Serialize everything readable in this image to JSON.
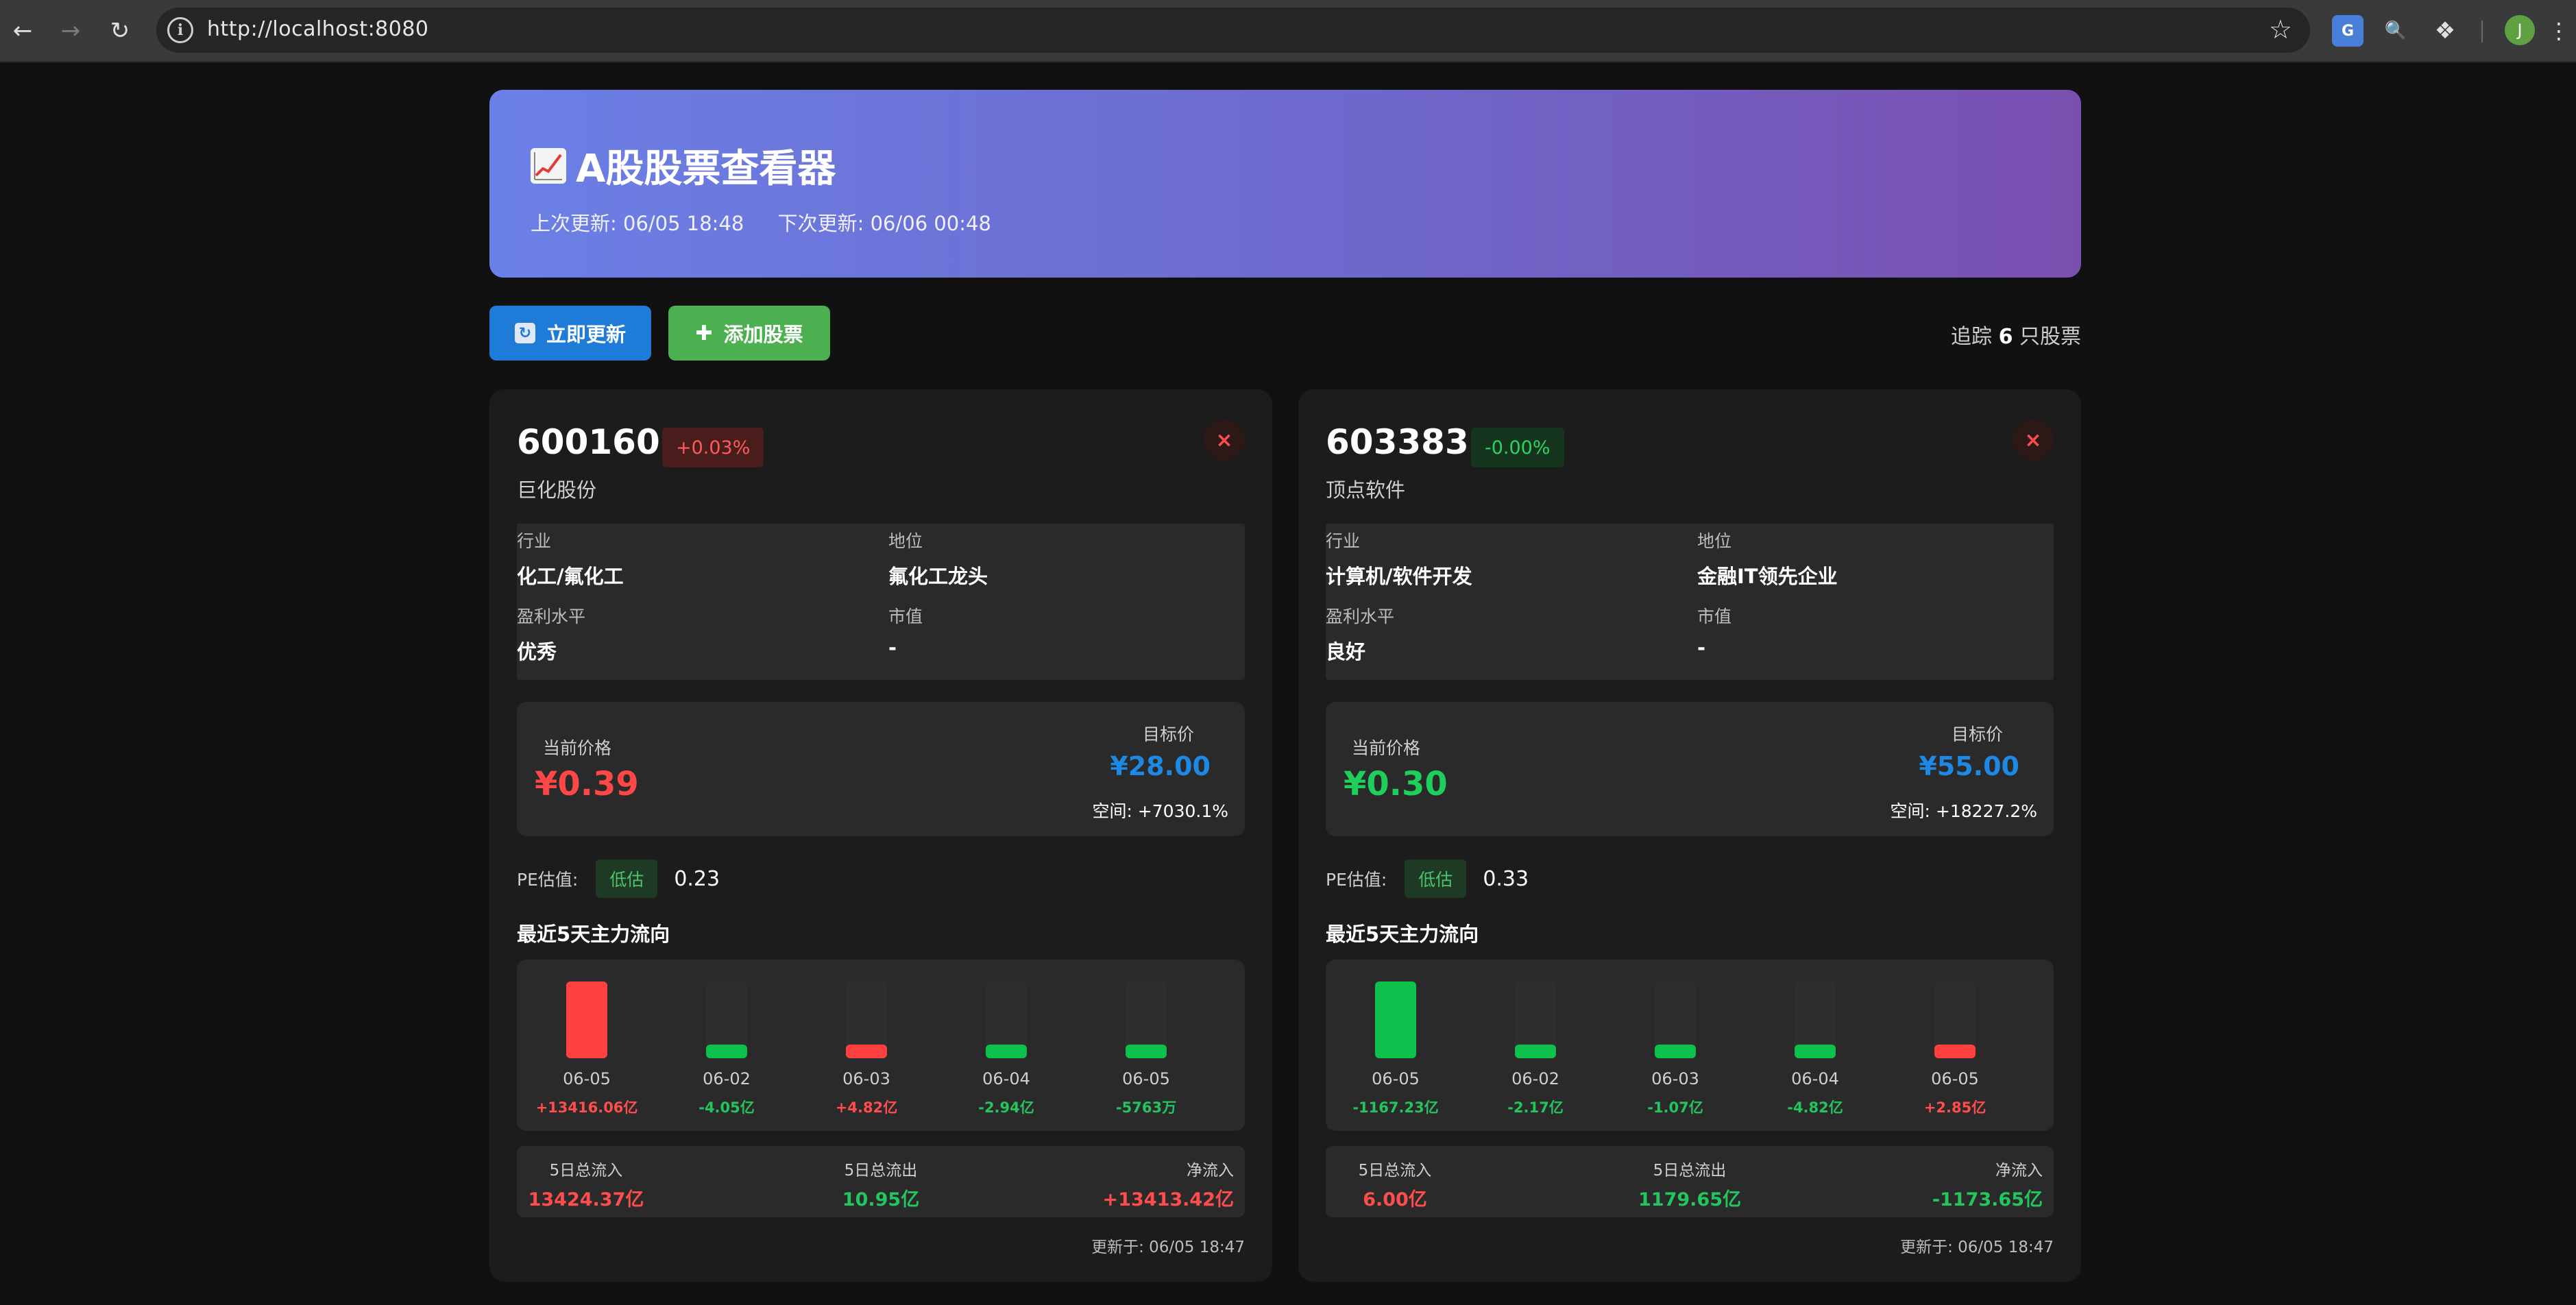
{
  "browser": {
    "url": "http://localhost:8080",
    "translate_ext_label": "G",
    "stock_ext_label": "🔍",
    "avatar_initial": "J"
  },
  "header": {
    "title": "A股股票查看器",
    "last_update": "上次更新: 06/05 18:48",
    "next_update": "下次更新: 06/06 00:48"
  },
  "actions": {
    "refresh_label": "立即更新",
    "add_label": "添加股票",
    "tracking_prefix": "追踪",
    "tracking_count": "6",
    "tracking_suffix": "只股票"
  },
  "labels": {
    "industry": "行业",
    "position": "地位",
    "profit_level": "盈利水平",
    "market_cap": "市值",
    "current_price": "当前价格",
    "target_price": "目标价",
    "pe_label": "PE估值:",
    "flow_title": "最近5天主力流向",
    "total_inflow": "5日总流入",
    "total_outflow": "5日总流出",
    "net_inflow": "净流入",
    "remove_symbol": "×"
  },
  "stocks": [
    {
      "code": "600160",
      "change": "+0.03%",
      "change_direction": "up",
      "name": "巨化股份",
      "industry": "化工/氟化工",
      "position": "氟化工龙头",
      "profit_level": "优秀",
      "market_cap": "-",
      "current_price": "¥0.39",
      "price_direction": "up",
      "target_price": "¥28.00",
      "upside": "空间: +7030.1%",
      "pe_badge": "低估",
      "pe_value": "0.23",
      "flows": [
        {
          "date": "06-05",
          "amount": "+13416.06亿",
          "direction": "up",
          "magnitude": 1.0
        },
        {
          "date": "06-02",
          "amount": "-4.05亿",
          "direction": "down",
          "magnitude": 0.05
        },
        {
          "date": "06-03",
          "amount": "+4.82亿",
          "direction": "up",
          "magnitude": 0.05
        },
        {
          "date": "06-04",
          "amount": "-2.94亿",
          "direction": "down",
          "magnitude": 0.05
        },
        {
          "date": "06-05",
          "amount": "-5763万",
          "direction": "down",
          "magnitude": 0.05
        }
      ],
      "total_inflow": "13424.37亿",
      "total_outflow": "10.95亿",
      "net_inflow": "+13413.42亿",
      "net_direction": "up",
      "updated_at": "更新于: 06/05 18:47"
    },
    {
      "code": "603383",
      "change": "-0.00%",
      "change_direction": "down",
      "name": "顶点软件",
      "industry": "计算机/软件开发",
      "position": "金融IT领先企业",
      "profit_level": "良好",
      "market_cap": "-",
      "current_price": "¥0.30",
      "price_direction": "down",
      "target_price": "¥55.00",
      "upside": "空间: +18227.2%",
      "pe_badge": "低估",
      "pe_value": "0.33",
      "flows": [
        {
          "date": "06-05",
          "amount": "-1167.23亿",
          "direction": "down",
          "magnitude": 1.0
        },
        {
          "date": "06-02",
          "amount": "-2.17亿",
          "direction": "down",
          "magnitude": 0.05
        },
        {
          "date": "06-03",
          "amount": "-1.07亿",
          "direction": "down",
          "magnitude": 0.05
        },
        {
          "date": "06-04",
          "amount": "-4.82亿",
          "direction": "down",
          "magnitude": 0.05
        },
        {
          "date": "06-05",
          "amount": "+2.85亿",
          "direction": "up",
          "magnitude": 0.05
        }
      ],
      "total_inflow": "6.00亿",
      "total_outflow": "1179.65亿",
      "net_inflow": "-1173.65亿",
      "net_direction": "down",
      "updated_at": "更新于: 06/05 18:47"
    }
  ]
}
